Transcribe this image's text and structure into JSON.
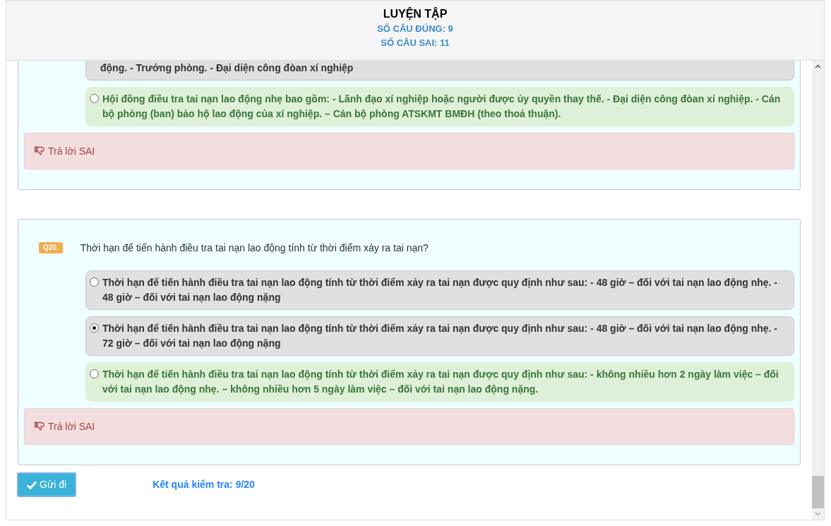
{
  "header": {
    "title": "LUYỆN TẬP",
    "correct_count": "SỐ CÂU ĐÚNG: 9",
    "wrong_count": "SỐ CÂU SAI: 11"
  },
  "questions": [
    {
      "clipped": true,
      "options": [
        {
          "text": "động. - Trưởng phòng. - Đại diện công đòan xí nghiệp",
          "correct": false,
          "clipped": true
        },
        {
          "text": "Hội đồng điều tra tai nạn lao động nhẹ bao gồm: - Lãnh đạo xí nghiệp hoặc người được ủy quyền thay thế. - Đại diện công đòan xí nghiệp. - Cán bộ phòng (ban) bảo hộ lao động của xí nghiệp. – Cán bộ phòng ATSKMT BMĐH (theo thoả thuận).",
          "correct": true,
          "selected": false
        }
      ],
      "result": "Trả lời SAI"
    },
    {
      "number": "Q20.",
      "text": "Thời hạn để tiến hành điều tra tai nạn lao động tính từ thời điểm xảy ra tai nạn?",
      "options": [
        {
          "text": "Thời hạn để tiến hành điều tra tai nạn lao động tính từ thời điểm xảy ra tai nạn được quy định như sau: - 48 giờ – đối với tai nạn lao động nhẹ. - 48 giờ – đối với tai nạn lao động nặng",
          "correct": false,
          "selected": false
        },
        {
          "text": "Thời hạn để tiến hành điều tra tai nạn lao động tính từ thời điểm xảy ra tai nạn được quy định như sau: - 48 giờ – đối với tai nạn lao động nhẹ. - 72 giờ – đối với tai nạn lao động nặng",
          "correct": false,
          "selected": true
        },
        {
          "text": "Thời hạn để tiến hành điều tra tai nạn lao động tính từ thời điểm xảy ra tai nạn được quy định như sau: - không nhiều hơn 2 ngày làm việc – đối với tai nạn lao động nhẹ. – không nhiều hơn 5 ngày làm việc – đối với tai nạn lao động nặng.",
          "correct": true,
          "selected": false
        }
      ],
      "result": "Trả lời SAI"
    }
  ],
  "submit_button": "Gửi đi",
  "score": "Kết quả kiểm tra: 9/20"
}
